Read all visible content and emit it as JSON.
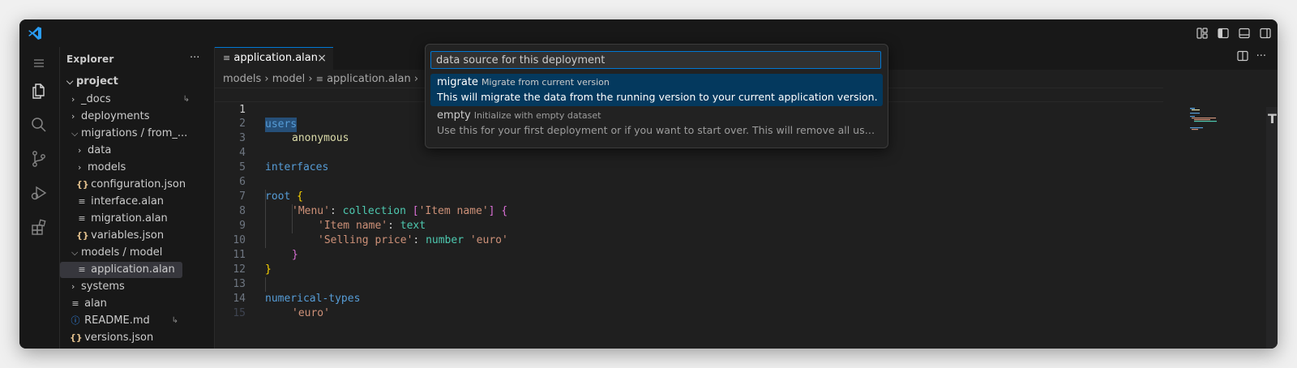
{
  "titlebar": {
    "logo_icon": "vscode-logo-icon",
    "layout_icons": [
      "customize-layout-icon",
      "toggle-primary-sidebar-icon",
      "toggle-panel-icon",
      "toggle-secondary-sidebar-icon"
    ]
  },
  "activitybar": {
    "items": [
      "menu-icon",
      "explorer-icon",
      "search-icon",
      "source-control-icon",
      "run-debug-icon",
      "extensions-icon"
    ]
  },
  "explorer": {
    "title": "Explorer",
    "more": "···",
    "root": "project",
    "items": [
      {
        "label": "_docs",
        "type": "folder-collapsed"
      },
      {
        "label": "deployments",
        "type": "folder-collapsed"
      },
      {
        "label": "migrations / from_...",
        "type": "folder-expanded"
      },
      {
        "label": "data",
        "type": "folder-collapsed"
      },
      {
        "label": "models",
        "type": "folder-collapsed"
      },
      {
        "label": "configuration.json",
        "type": "json"
      },
      {
        "label": "interface.alan",
        "type": "text"
      },
      {
        "label": "migration.alan",
        "type": "text"
      },
      {
        "label": "variables.json",
        "type": "json"
      },
      {
        "label": "models / model",
        "type": "folder-expanded"
      },
      {
        "label": "application.alan",
        "type": "text"
      },
      {
        "label": "systems",
        "type": "folder-collapsed"
      },
      {
        "label": "alan",
        "type": "text"
      },
      {
        "label": "README.md",
        "type": "info"
      },
      {
        "label": "versions.json",
        "type": "json"
      }
    ]
  },
  "editor": {
    "tab": {
      "label": "application.alan",
      "close": "×"
    },
    "breadcrumb": [
      "models",
      "model",
      "application.alan"
    ],
    "line_numbers": [
      "1",
      "2",
      "3",
      "4",
      "5",
      "6",
      "7",
      "8",
      "9",
      "10",
      "11",
      "12",
      "13",
      "14",
      "15"
    ],
    "lines": {
      "l1": "users",
      "l2": "anonymous",
      "l4": "interfaces",
      "l6a": "root",
      "l6b": "{",
      "l7a": "'Menu'",
      "l7b": ": ",
      "l7c": "collection",
      "l7d": "[",
      "l7e": "'Item name'",
      "l7f": "]",
      "l7g": "{",
      "l8a": "'Item name'",
      "l8b": ": ",
      "l8c": "text",
      "l9a": "'Selling price'",
      "l9b": ": ",
      "l9c": "number",
      "l9d": "'euro'",
      "l10": "}",
      "l11": "}",
      "l13": "numerical-types",
      "l14": "'euro'"
    }
  },
  "quickpick": {
    "input_value": "data source for this deployment",
    "items": [
      {
        "label": "migrate",
        "description": "Migrate from current version",
        "detail": "This will migrate the data from the running version to your current application version.",
        "active": true
      },
      {
        "label": "empty",
        "description": "Initialize with empty dataset",
        "detail": "Use this for your first deployment or if you want to start over. This will remove all use...",
        "active": false
      }
    ]
  },
  "colors": {
    "accent": "#0078d4",
    "selection": "#04395e",
    "background": "#1f1f1f"
  }
}
